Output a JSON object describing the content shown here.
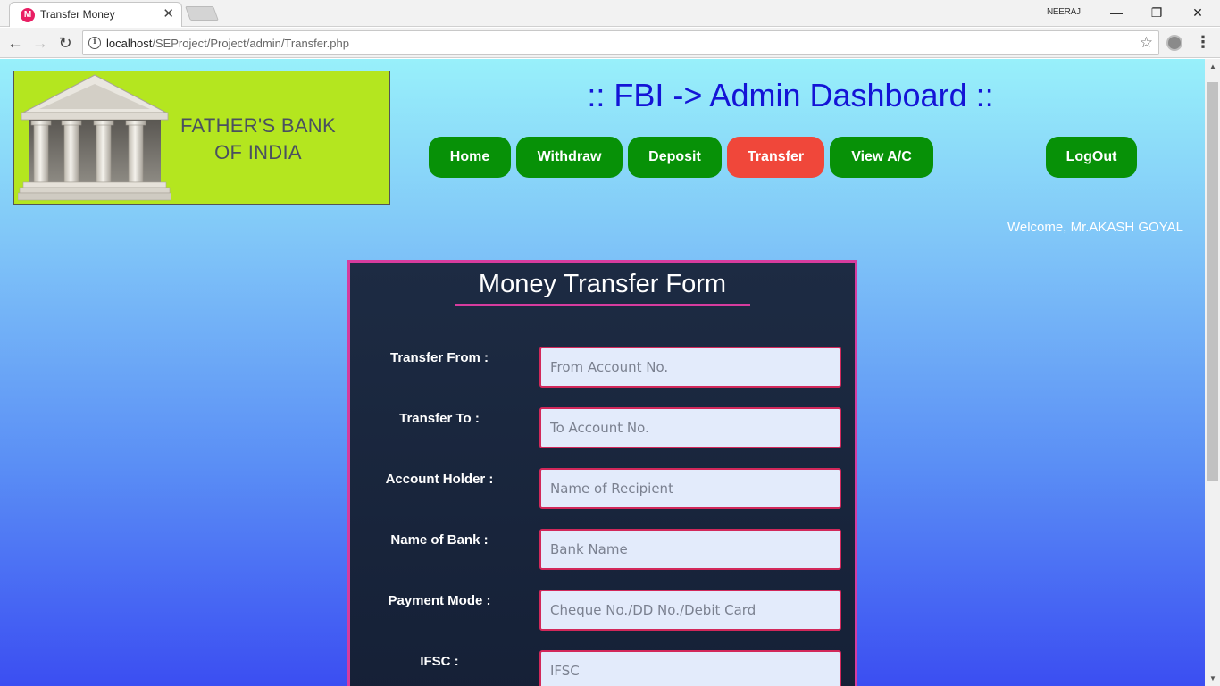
{
  "browser": {
    "tab_title": "Transfer Money",
    "tab_favicon": "M",
    "profile_name": "NEERAJ",
    "url_host": "localhost",
    "url_path": "/SEProject/Project/admin/Transfer.php"
  },
  "header": {
    "logo_line1": "FATHER'S BANK",
    "logo_line2": "OF INDIA",
    "title": ":: FBI -> Admin Dashboard ::"
  },
  "nav": {
    "home": "Home",
    "withdraw": "Withdraw",
    "deposit": "Deposit",
    "transfer": "Transfer",
    "view_ac": "View A/C",
    "logout": "LogOut"
  },
  "welcome": "Welcome, Mr.AKASH GOYAL",
  "form": {
    "title": "Money Transfer Form",
    "fields": [
      {
        "label": "Transfer From :",
        "placeholder": "From Account No."
      },
      {
        "label": "Transfer To :",
        "placeholder": "To Account No."
      },
      {
        "label": "Account Holder :",
        "placeholder": "Name of Recipient"
      },
      {
        "label": "Name of Bank :",
        "placeholder": "Bank Name"
      },
      {
        "label": "Payment Mode :",
        "placeholder": "Cheque No./DD No./Debit Card"
      },
      {
        "label": "IFSC :",
        "placeholder": "IFSC"
      }
    ]
  },
  "colors": {
    "nav_button": "#079107",
    "nav_active": "#f0473a",
    "title_blue": "#1414d6",
    "form_border": "#d63c9e",
    "logo_bg": "#b4e61f"
  }
}
